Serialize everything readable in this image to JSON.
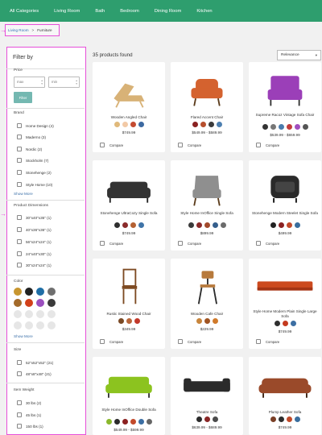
{
  "nav": {
    "items": [
      "All Categories",
      "Living Room",
      "Bath",
      "Bedroom",
      "Dining Room",
      "Kitchen"
    ]
  },
  "breadcrumb": {
    "link": "Living Room",
    "separator": ">",
    "current": "Furniture"
  },
  "sidebar": {
    "title": "Filter by",
    "price": {
      "label": "Price",
      "min_placeholder": "max",
      "max_placeholder": "min",
      "dash": "–",
      "button": "Filter"
    },
    "brand": {
      "label": "Brand",
      "items": [
        "Home Design (4)",
        "Maderno (3)",
        "Nordic (2)",
        "Stockholm (7)",
        "Stonehenge (2)",
        "Style Home (10)"
      ],
      "show_more": "Show More"
    },
    "dimensions": {
      "label": "Product Dimensions",
      "items": [
        "30\"x40\"x35\" (1)",
        "40\"x36\"x36\" (1)",
        "56\"x24\"x24\" (1)",
        "24\"x40\"x30\" (1)",
        "30\"x24\"x24\" (1)"
      ]
    },
    "color": {
      "label": "Color",
      "swatches": [
        "#c8962f",
        "#222222",
        "#1f6ea6",
        "#6f6f6f",
        "#a36a2a",
        "#d2401a",
        "#9b4fbf",
        "#3a3a3a",
        "#e0e0e0",
        "#e0e0e0",
        "#e0e0e0",
        "#e0e0e0",
        "#e0e0e0",
        "#e0e0e0",
        "#e0e0e0",
        "#e0e0e0"
      ],
      "show_more": "Show More"
    },
    "size": {
      "label": "Size",
      "items": [
        "52\"x52\"x52\" (21)",
        "48\"x8\"x48\" (21)"
      ]
    },
    "weight": {
      "label": "Item Weight",
      "items": [
        "30 lbs (2)",
        "45 lbs (1)",
        "150 lbs (1)"
      ]
    }
  },
  "results": {
    "count_text": "35 products found",
    "sort_value": "Relevance",
    "compare_label": "Compare",
    "products": [
      {
        "name": "Wooden Angled Chair",
        "price": "$749.99",
        "colors": [
          "#e0b97a",
          "#f2c9a6",
          "#c44b31",
          "#3d6aa1"
        ],
        "icon": "lounge-chair-icon",
        "tone": "#d8b277"
      },
      {
        "name": "Flared Accent Chair",
        "price": "$549.99 - $589.99",
        "colors": [
          "#8a2121",
          "#b74f2d",
          "#3b3b3b",
          "#4d7fb0"
        ],
        "icon": "armchair-icon",
        "tone": "#d4622f"
      },
      {
        "name": "Supreme Racoz Vintage Sofa Chair",
        "price": "$539.99 - $659.99",
        "colors": [
          "#333333",
          "#777777",
          "#4a7cad",
          "#c23d3d",
          "#a14fbf",
          "#555555"
        ],
        "icon": "tufted-chair-icon",
        "tone": "#9b3fb8"
      },
      {
        "name": "Stonehenge UltraCozy Single Sofa",
        "price": "$749.99",
        "colors": [
          "#2e2e2e",
          "#8b2c2c",
          "#b46133",
          "#3f74a8"
        ],
        "icon": "chesterfield-sofa-icon",
        "tone": "#333333"
      },
      {
        "name": "Style Home InOffice Single Sofa",
        "price": "$899.99",
        "colors": [
          "#3a3a3a",
          "#8a2a2a",
          "#a24a2c",
          "#355f8c",
          "#6b6b6b"
        ],
        "icon": "wingback-chair-icon",
        "tone": "#8f8f8f"
      },
      {
        "name": "Stonehenge Modern Steelet Single Sofa",
        "price": "$499.99",
        "colors": [
          "#222222",
          "#8b2121",
          "#c24a2b",
          "#3a6e9e"
        ],
        "icon": "club-chair-icon",
        "tone": "#2a2a2a"
      },
      {
        "name": "Rustic Stained Wood Chair",
        "price": "$349.99",
        "colors": [
          "#7a4a25",
          "#b9663a",
          "#c2392b"
        ],
        "icon": "wood-chair-icon",
        "tone": "#7d4a22"
      },
      {
        "name": "Wooden Cafe Chair",
        "price": "$229.99",
        "colors": [
          "#c8853c",
          "#a05422",
          "#d07a2b"
        ],
        "icon": "cafe-chair-icon",
        "tone": "#b77a3c"
      },
      {
        "name": "Style Home Modern Plain Single Large Sofa",
        "price": "$749.99",
        "colors": [
          "#2f2f2f",
          "#c43a1f",
          "#3c6fa3"
        ],
        "icon": "long-sofa-icon",
        "tone": "#cc4a1e"
      },
      {
        "name": "Style Home InOffice Double Sofa",
        "price": "$549.99 - $599.99",
        "colors": [
          "#8ab82c",
          "#2a2a2a",
          "#8b2121",
          "#c24a2b",
          "#3b6ea3",
          "#666666"
        ],
        "icon": "double-sofa-icon",
        "tone": "#8cc31f"
      },
      {
        "name": "Theatre Sofa",
        "price": "$639.99 - $689.99",
        "colors": [
          "#2b2b2b",
          "#8a2727",
          "#4a4a4a"
        ],
        "icon": "theatre-sofa-icon",
        "tone": "#2b2b2b"
      },
      {
        "name": "Plump Leather Sofa",
        "price": "$749.99",
        "colors": [
          "#7a3f26",
          "#2d2d2d",
          "#c04a2a",
          "#3a6e9e"
        ],
        "icon": "leather-sofa-icon",
        "tone": "#9a4a2a"
      }
    ]
  }
}
